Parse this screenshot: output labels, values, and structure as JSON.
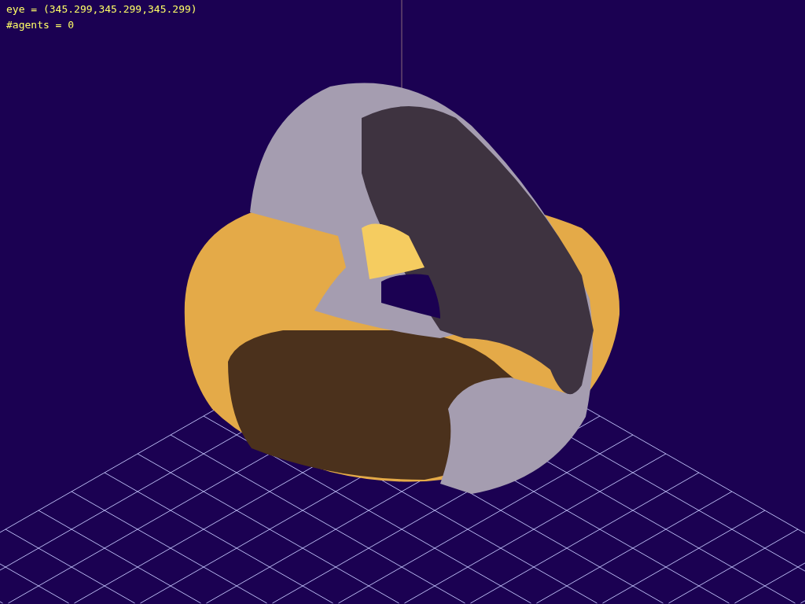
{
  "overlay": {
    "lines": [
      "eye = (345.299,345.299,345.299)",
      "#agents = 0"
    ]
  }
}
